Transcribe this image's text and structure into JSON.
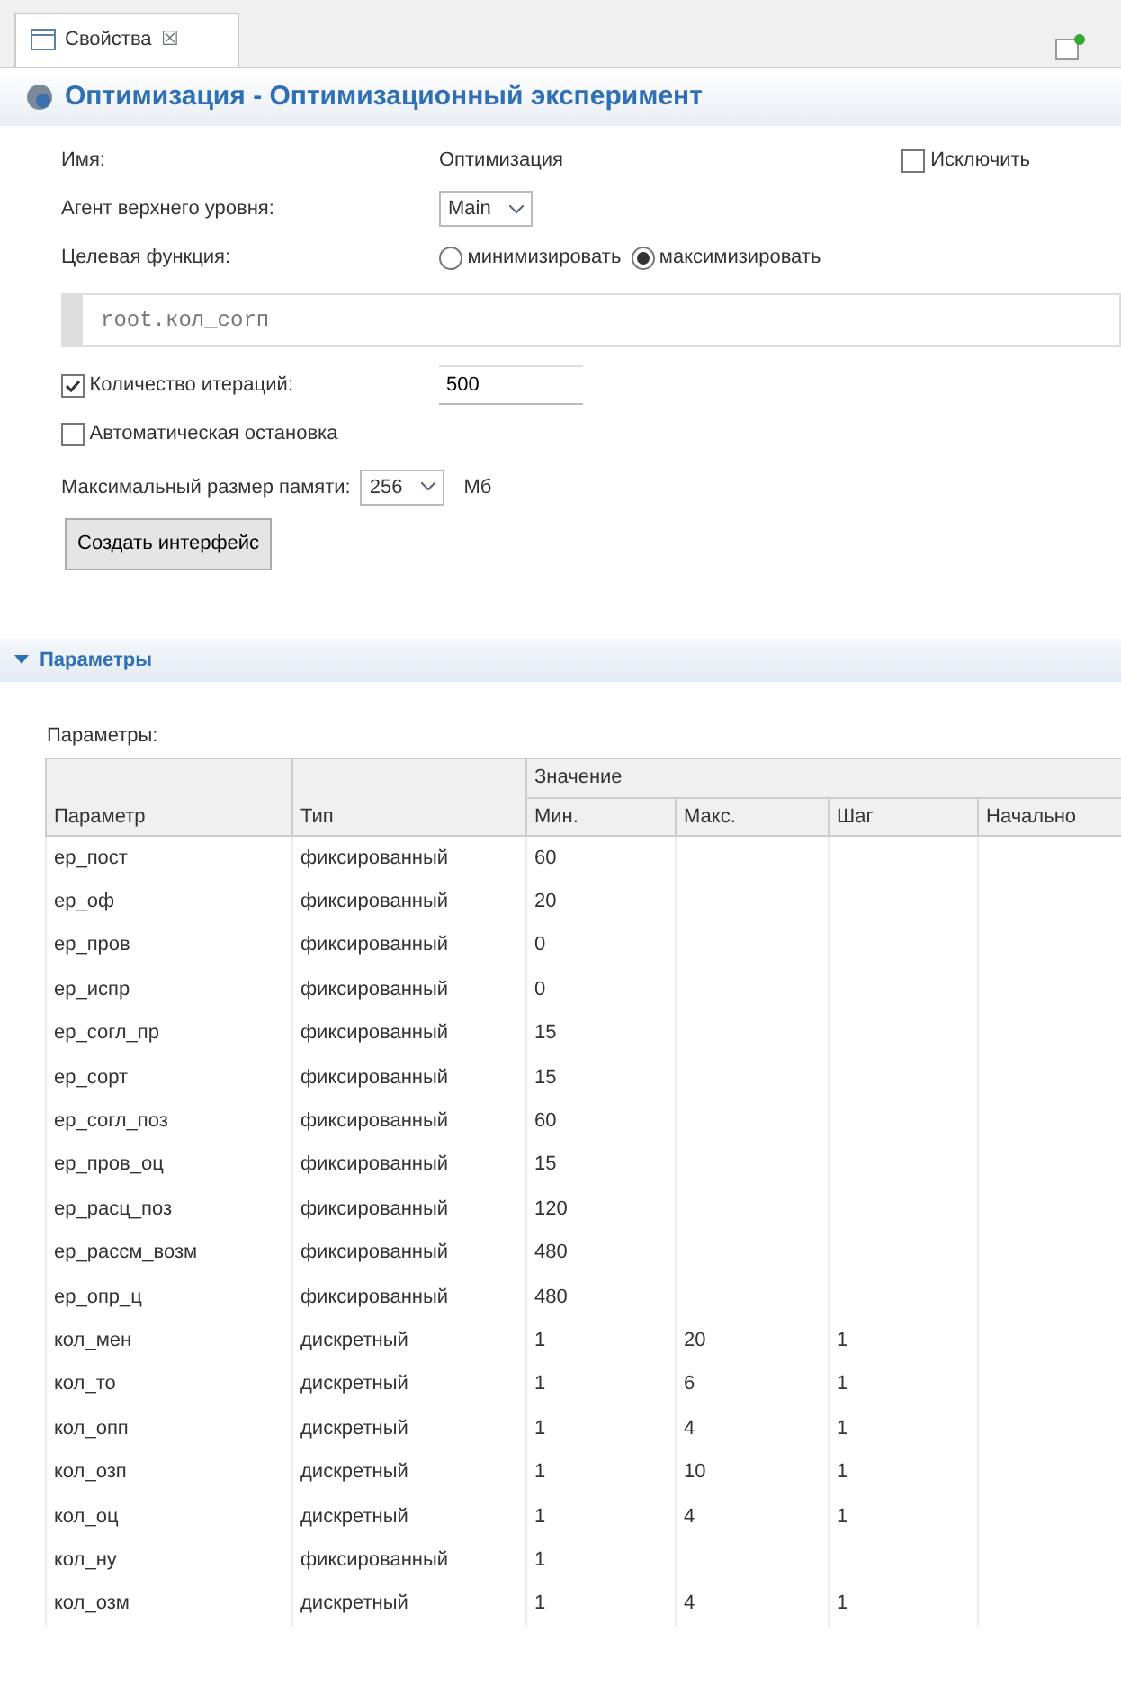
{
  "view_tab": {
    "label": "Свойства",
    "close": "☒"
  },
  "title": "Оптимизация - Оптимизационный эксперимент",
  "name_label": "Имя:",
  "name_value": "Оптимизация",
  "exclude": {
    "label": "Исключить",
    "checked": false
  },
  "top_agent": {
    "label": "Агент верхнего уровня:",
    "value": "Main"
  },
  "objective": {
    "label": "Целевая функция:",
    "options": [
      {
        "label": "минимизировать",
        "selected": false
      },
      {
        "label": "максимизировать",
        "selected": true
      }
    ]
  },
  "expression": "root.кол_corп",
  "iterations": {
    "label": "Количество итераций:",
    "checked": true,
    "value": "500"
  },
  "auto_stop": {
    "label": "Автоматическая остановка",
    "checked": false
  },
  "memory": {
    "label": "Максимальный размер памяти:",
    "value": "256",
    "unit": "Мб"
  },
  "create_button": "Создать интерфейс",
  "section": {
    "title": "Параметры",
    "expanded": true
  },
  "table_label": "Параметры:",
  "table": {
    "group_header": "Значение",
    "columns": [
      "Параметр",
      "Тип",
      "Мин.",
      "Макс.",
      "Шаг",
      "Начально"
    ],
    "rows": [
      {
        "name": "ep_пост",
        "type": "фиксированный",
        "min": "60"
      },
      {
        "name": "ep_оф",
        "type": "фиксированный",
        "min": "20"
      },
      {
        "name": "ep_пров",
        "type": "фиксированный",
        "min": "0"
      },
      {
        "name": "ep_испр",
        "type": "фиксированный",
        "min": "0"
      },
      {
        "name": "ep_согл_пр",
        "type": "фиксированный",
        "min": "15"
      },
      {
        "name": "ep_сорт",
        "type": "фиксированный",
        "min": "15"
      },
      {
        "name": "ep_согл_поз",
        "type": "фиксированный",
        "min": "60"
      },
      {
        "name": "ep_пров_оц",
        "type": "фиксированный",
        "min": "15"
      },
      {
        "name": "ep_расц_поз",
        "type": "фиксированный",
        "min": "120"
      },
      {
        "name": "ep_рассм_возм",
        "type": "фиксированный",
        "min": "480"
      },
      {
        "name": "ep_опр_ц",
        "type": "фиксированный",
        "min": "480"
      },
      {
        "name": "кол_мен",
        "type": "дискретный",
        "min": "1",
        "max": "20",
        "step": "1"
      },
      {
        "name": "кол_то",
        "type": "дискретный",
        "min": "1",
        "max": "6",
        "step": "1"
      },
      {
        "name": "кол_опп",
        "type": "дискретный",
        "min": "1",
        "max": "4",
        "step": "1"
      },
      {
        "name": "кол_озп",
        "type": "дискретный",
        "min": "1",
        "max": "10",
        "step": "1"
      },
      {
        "name": "кол_оц",
        "type": "дискретный",
        "min": "1",
        "max": "4",
        "step": "1"
      },
      {
        "name": "кол_ну",
        "type": "фиксированный",
        "min": "1"
      },
      {
        "name": "кол_озм",
        "type": "дискретный",
        "min": "1",
        "max": "4",
        "step": "1"
      }
    ]
  }
}
